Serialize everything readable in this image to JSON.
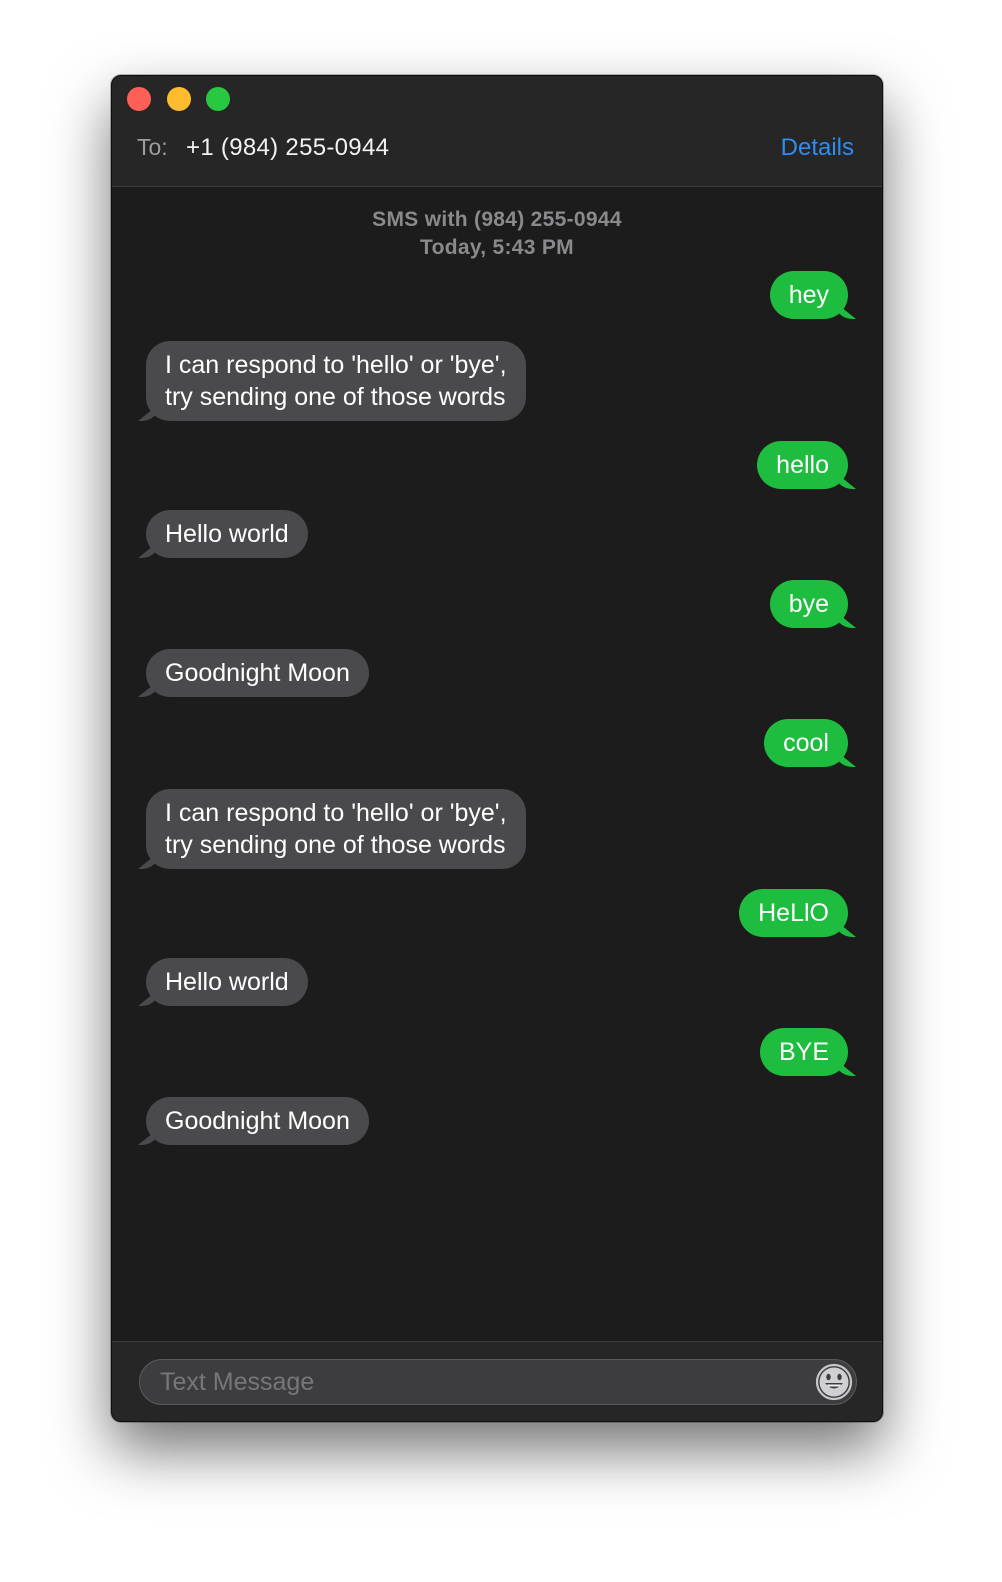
{
  "window": {
    "to_label": "To:",
    "to_value": "+1 (984) 255-0944",
    "details_label": "Details"
  },
  "conversation": {
    "header_line1": "SMS with (984) 255-0944",
    "header_line2": "Today, 5:43 PM",
    "messages": [
      {
        "from": "me",
        "text": "hey"
      },
      {
        "from": "them",
        "lines": [
          "I can respond to 'hello' or 'bye',",
          "try sending one of those words"
        ]
      },
      {
        "from": "me",
        "text": "hello"
      },
      {
        "from": "them",
        "text": "Hello world"
      },
      {
        "from": "me",
        "text": "bye"
      },
      {
        "from": "them",
        "text": "Goodnight Moon"
      },
      {
        "from": "me",
        "text": "cool"
      },
      {
        "from": "them",
        "lines": [
          "I can respond to 'hello' or 'bye',",
          "try sending one of those words"
        ]
      },
      {
        "from": "me",
        "text": "HeLlO"
      },
      {
        "from": "them",
        "text": "Hello world"
      },
      {
        "from": "me",
        "text": "BYE"
      },
      {
        "from": "them",
        "text": "Goodnight Moon"
      }
    ]
  },
  "composer": {
    "placeholder": "Text Message",
    "value": "",
    "emoji_icon": "emoji-icon"
  },
  "colors": {
    "sent_bubble": "#1ebd3f",
    "received_bubble": "#4a4a4c",
    "link": "#2f8cf5",
    "close": "#fe5f57",
    "minimize": "#febc2e",
    "zoom": "#28c840"
  }
}
